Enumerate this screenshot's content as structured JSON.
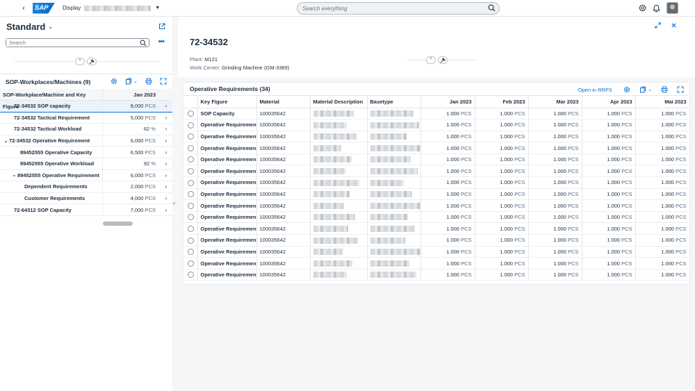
{
  "shell": {
    "logo_text": "SAP",
    "app_title": "Display",
    "search_placeholder": "Search everything"
  },
  "left": {
    "variant_title": "Standard",
    "search_placeholder": "Search",
    "more_label": "•••",
    "table_title": "SOP-Workplaces/Machines (9)",
    "columns": [
      "SOP-Workplace/Machine and Key Figure",
      "Jan 2023"
    ],
    "rows": [
      {
        "label": "72-34532 SOP capacity",
        "value": "8,000",
        "unit": "PCS",
        "indent": 0,
        "expander": "",
        "selected": true
      },
      {
        "label": "72-34532 Tactical Requirement",
        "value": "5,000",
        "unit": "PCS",
        "indent": 0,
        "expander": ""
      },
      {
        "label": "72-34532 Tactical Workload",
        "value": "62",
        "unit": "%",
        "indent": 0,
        "expander": ""
      },
      {
        "label": "72-34532 Operative Requirement",
        "value": "6,000",
        "unit": "PCS",
        "indent": 0,
        "expander": "⌄"
      },
      {
        "label": "89452555 Operative Capacity",
        "value": "6,500",
        "unit": "PCS",
        "indent": 1,
        "expander": ""
      },
      {
        "label": "89452555 Operative Workload",
        "value": "92",
        "unit": "%",
        "indent": 1,
        "expander": ""
      },
      {
        "label": "89452555 Operative Requirement",
        "value": "6,000",
        "unit": "PCS",
        "indent": 1,
        "expander": "⌄"
      },
      {
        "label": "Dependent Requirements",
        "value": "2,000",
        "unit": "PCS",
        "indent": 2,
        "expander": ""
      },
      {
        "label": "Customer Requirements",
        "value": "4,000",
        "unit": "PCS",
        "indent": 2,
        "expander": ""
      },
      {
        "label": "72-64312 SOP Capacity",
        "value": "7,000",
        "unit": "PCS",
        "indent": 0,
        "expander": ""
      }
    ]
  },
  "right": {
    "object_title": "72-34532",
    "plant_label": "Plant:",
    "plant_value": "M121",
    "workcenter_label": "Work Center:",
    "workcenter_value": "Grinding Machine (GM-3389)",
    "card_title": "Operative Requirements (34)",
    "open_link": "Open in RRP3",
    "columns": [
      "Key Figure",
      "Material",
      "Material Description",
      "Basetype",
      "Jan 2023",
      "Feb 2023",
      "Mar 2023",
      "Apr 2023",
      "Mai 2023"
    ],
    "rows": [
      {
        "key_figure": "SOP Capacity",
        "material": "100035642"
      },
      {
        "key_figure": "Operative Requirement",
        "material": "100035642"
      },
      {
        "key_figure": "Operative Requirement",
        "material": "100035642"
      },
      {
        "key_figure": "Operative Requirement",
        "material": "100035642"
      },
      {
        "key_figure": "Operative Requirement",
        "material": "100035642"
      },
      {
        "key_figure": "Operative Requirement",
        "material": "100035642"
      },
      {
        "key_figure": "Operative Requirement",
        "material": "100035642"
      },
      {
        "key_figure": "Operative Requirement",
        "material": "100035642"
      },
      {
        "key_figure": "Operative Requirement",
        "material": "100035642"
      },
      {
        "key_figure": "Operative Requirement",
        "material": "100035642"
      },
      {
        "key_figure": "Operative Requirement",
        "material": "100035642"
      },
      {
        "key_figure": "Operative Requirement",
        "material": "100035642"
      },
      {
        "key_figure": "Operative Requirement",
        "material": "100035642"
      },
      {
        "key_figure": "Operative Requirement",
        "material": "100035642"
      },
      {
        "key_figure": "Operative Requirement",
        "material": "100035642"
      }
    ],
    "month_value": "1.000",
    "month_unit": "PCS"
  },
  "colors": {
    "accent": "#0a6ed1",
    "selection": "#eaf3fc",
    "text": "#1d2d3e"
  }
}
